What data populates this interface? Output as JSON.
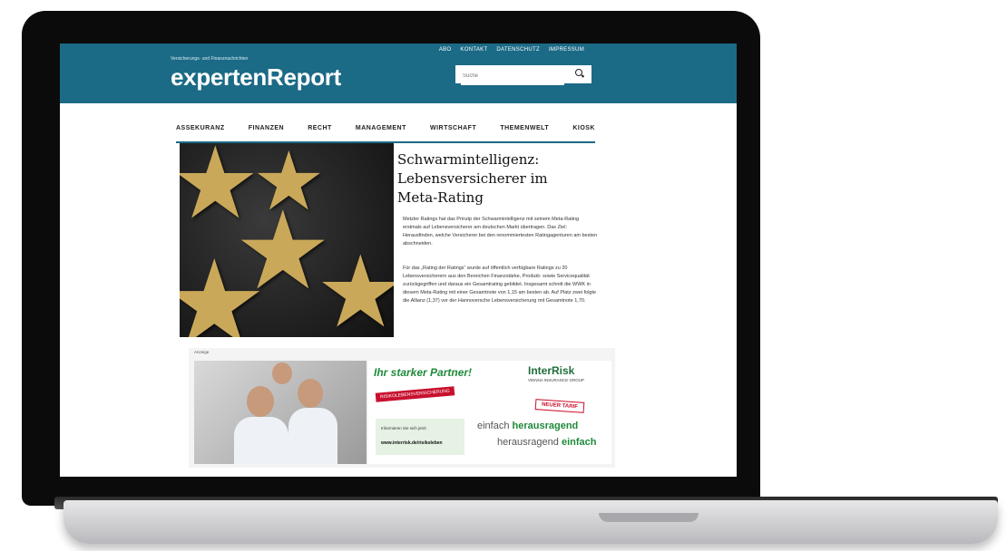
{
  "site": {
    "tagline": "Versicherungs- und Finanznachrichten",
    "logo": "expertenReport",
    "top_links": [
      "ABO",
      "KONTAKT",
      "DATENSCHUTZ",
      "IMPRESSUM"
    ],
    "search_placeholder": "Suche",
    "nav": [
      "ASSEKURANZ",
      "FINANZEN",
      "RECHT",
      "MANAGEMENT",
      "WIRTSCHAFT",
      "THEMENWELT",
      "KIOSK"
    ]
  },
  "article": {
    "headline": "Schwarmintelligenz: Lebensversicherer im Meta-Rating",
    "para1": "Metzler Ratings hat das Prinzip der Schwarmintelligenz mit seinem Meta-Rating erstmals auf Lebensversicherer am deutschen Markt übertragen. Das Ziel: Herausfinden, welche Versicherer bei den renommiertesten Ratingagenturen am besten abschneiden.",
    "para2": "Für das „Rating der Ratings“ wurde auf öffentlich verfügbare Ratings zu 20 Lebensversicherern aus den Bereichen Finanzstärke, Produkt- sowie Servicequalität zurückgegriffen und daraus ein Gesamtrating gebildet. Insgesamt schnitt die WWK in diesem Meta-Rating mit einer Gesamtnote von 1,15 am besten ab. Auf Platz zwei folgte die Allianz (1,37) vor der Hannoversche Lebensversicherung mit Gesamtnote 1,70."
  },
  "ad": {
    "label": "Anzeige",
    "slogan": "Ihr starker Partner!",
    "brand": "InterRisk",
    "group": "VIENNA INSURANCE GROUP",
    "red_bar": "RISIKOLEBENSVERSICHERUNG",
    "badge": "NEUER TARIF",
    "info_line1": "Informieren Sie sich jetzt:",
    "info_line2": "www.interrisk.de/risikoleben",
    "tag1_a": "einfach ",
    "tag1_b": "herausragend",
    "tag2_a": "herausragend ",
    "tag2_b": "einfach"
  },
  "icons": [
    "search-icon",
    "star-image",
    "family-photo",
    "interrisk-logo"
  ]
}
